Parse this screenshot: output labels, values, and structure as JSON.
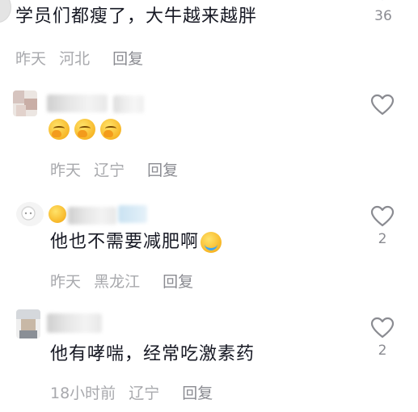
{
  "comments": [
    {
      "text": "学员们都瘦了，大牛越来越胖",
      "time": "昨天",
      "location": "河北",
      "reply_label": "回复",
      "like_count": "36"
    },
    {
      "emojis": [
        "cover-mouth-emoji",
        "cover-mouth-emoji",
        "cover-mouth-emoji"
      ],
      "time": "昨天",
      "location": "辽宁",
      "reply_label": "回复"
    },
    {
      "text": "他也不需要减肥啊",
      "emoji": "crying-emoji",
      "time": "昨天",
      "location": "黑龙江",
      "reply_label": "回复",
      "like_count": "2"
    },
    {
      "text": "他有哮喘，经常吃激素药",
      "time": "18小时前",
      "location": "辽宁",
      "reply_label": "回复",
      "like_count": "2"
    }
  ],
  "icons": {
    "like": "heart-outline-icon"
  },
  "colors": {
    "text": "#161823",
    "meta": "#a8a9ad",
    "reply": "#8a8b91"
  }
}
